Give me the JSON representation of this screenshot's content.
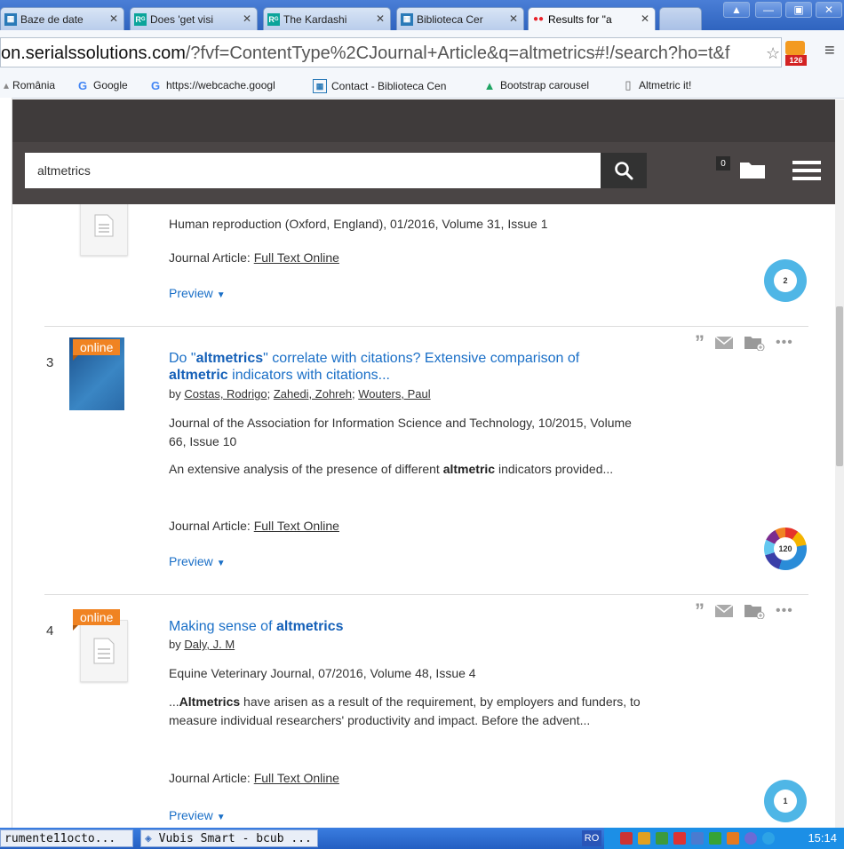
{
  "tabs": [
    {
      "label": "Baze de date",
      "icon": "library-icon"
    },
    {
      "label": "Does 'get visi",
      "icon": "researchgate-icon"
    },
    {
      "label": "The Kardashi",
      "icon": "researchgate-icon"
    },
    {
      "label": "Biblioteca Cer",
      "icon": "library-icon"
    },
    {
      "label": "Results for \"a",
      "icon": "summon-icon"
    }
  ],
  "address": {
    "host": "on.serialssolutions.com",
    "path": "/?fvf=ContentType%2CJournal+Article&q=altmetrics#!/search?ho=t&f",
    "rss_count": "126"
  },
  "bookmarks": [
    {
      "label": "România"
    },
    {
      "label": "Google"
    },
    {
      "label": "https://webcache.googl"
    },
    {
      "label": "Contact - Biblioteca Cen"
    },
    {
      "label": "Bootstrap carousel"
    },
    {
      "label": "Altmetric it!"
    }
  ],
  "search": {
    "query": "altmetrics",
    "folder_count": "0"
  },
  "results": [
    {
      "meta": "Human reproduction (Oxford, England), 01/2016, Volume 31, Issue 1",
      "type_label": "Journal Article:",
      "fulltext": "Full Text Online",
      "preview": "Preview",
      "altmetric": "2"
    },
    {
      "num": "3",
      "badge": "online",
      "title_pre": "Do \"",
      "title_b1": "altmetrics",
      "title_mid": "\" correlate with citations? Extensive comparison of ",
      "title_b2": "altmetric",
      "title_post": " indicators with citations...",
      "by": "by",
      "authors": [
        "Costas, Rodrigo",
        "Zahedi, Zohreh",
        "Wouters, Paul"
      ],
      "meta": "Journal of the Association for Information Science and Technology, 10/2015, Volume 66, Issue 10",
      "snip_pre": "An extensive analysis of the presence of different ",
      "snip_b": "altmetric",
      "snip_post": " indicators provided...",
      "type_label": "Journal Article:",
      "fulltext": "Full Text Online",
      "preview": "Preview",
      "altmetric": "120"
    },
    {
      "num": "4",
      "badge": "online",
      "title_pre": "Making sense of ",
      "title_b1": "altmetrics",
      "by": "by",
      "authors": [
        "Daly, J. M"
      ],
      "meta": "Equine Veterinary Journal, 07/2016, Volume 48, Issue 4",
      "snip_pre": "...",
      "snip_b": "Altmetrics",
      "snip_post": " have arisen as a result of the requirement, by employers and funders, to measure individual researchers' productivity and impact. Before the advent...",
      "type_label": "Journal Article:",
      "fulltext": "Full Text Online",
      "preview": "Preview",
      "altmetric": "1"
    }
  ],
  "taskbar": {
    "items": [
      {
        "label": "rumente11octo..."
      },
      {
        "label": "Vubis Smart - bcub ..."
      }
    ],
    "lang": "RO",
    "clock": "15:14"
  }
}
